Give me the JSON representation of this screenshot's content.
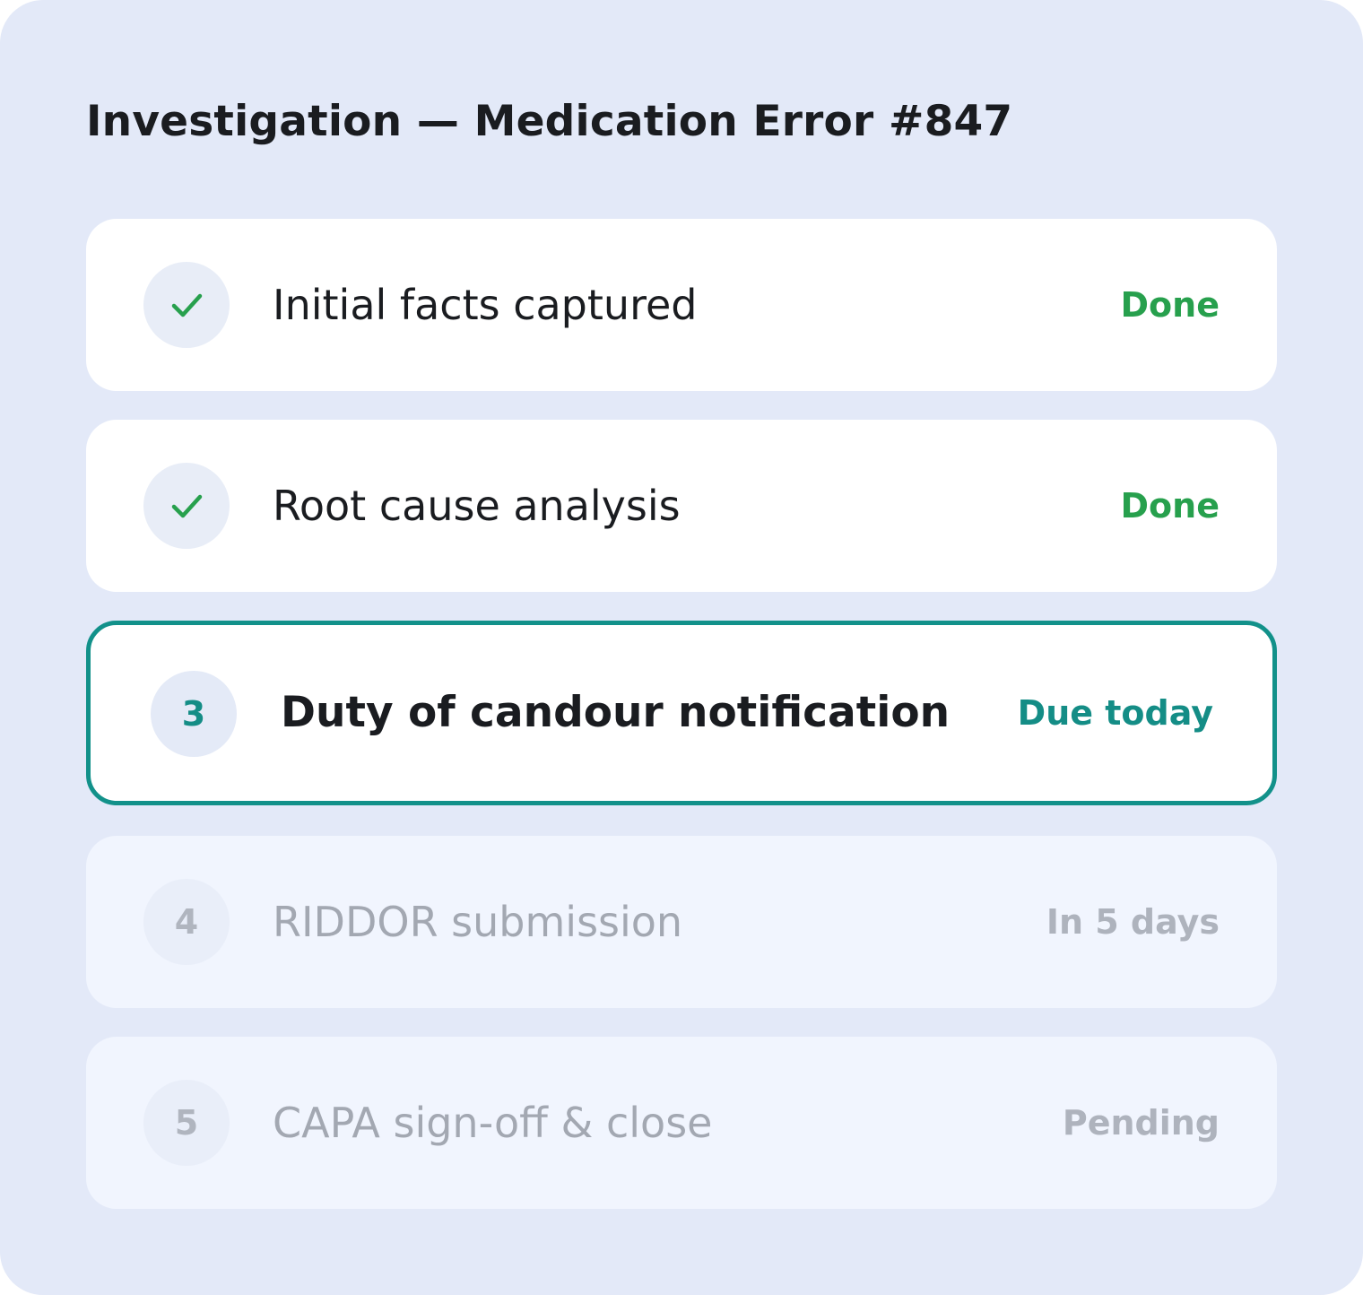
{
  "title": "Investigation — Medication Error #847",
  "colors": {
    "panel_background": "#e3e9f8",
    "done": "#27a04d",
    "current_accent": "#12918a",
    "muted": "#aeb3bd"
  },
  "steps": [
    {
      "marker_icon": "check-icon",
      "marker_text": "",
      "label": "Initial facts captured",
      "status": "Done",
      "state": "done"
    },
    {
      "marker_icon": "check-icon",
      "marker_text": "",
      "label": "Root cause analysis",
      "status": "Done",
      "state": "done"
    },
    {
      "marker_icon": "",
      "marker_text": "3",
      "label": "Duty of candour notification",
      "status": "Due today",
      "state": "current"
    },
    {
      "marker_icon": "",
      "marker_text": "4",
      "label": "RIDDOR submission",
      "status": "In 5 days",
      "state": "upcoming"
    },
    {
      "marker_icon": "",
      "marker_text": "5",
      "label": "CAPA sign-off & close",
      "status": "Pending",
      "state": "upcoming"
    }
  ]
}
